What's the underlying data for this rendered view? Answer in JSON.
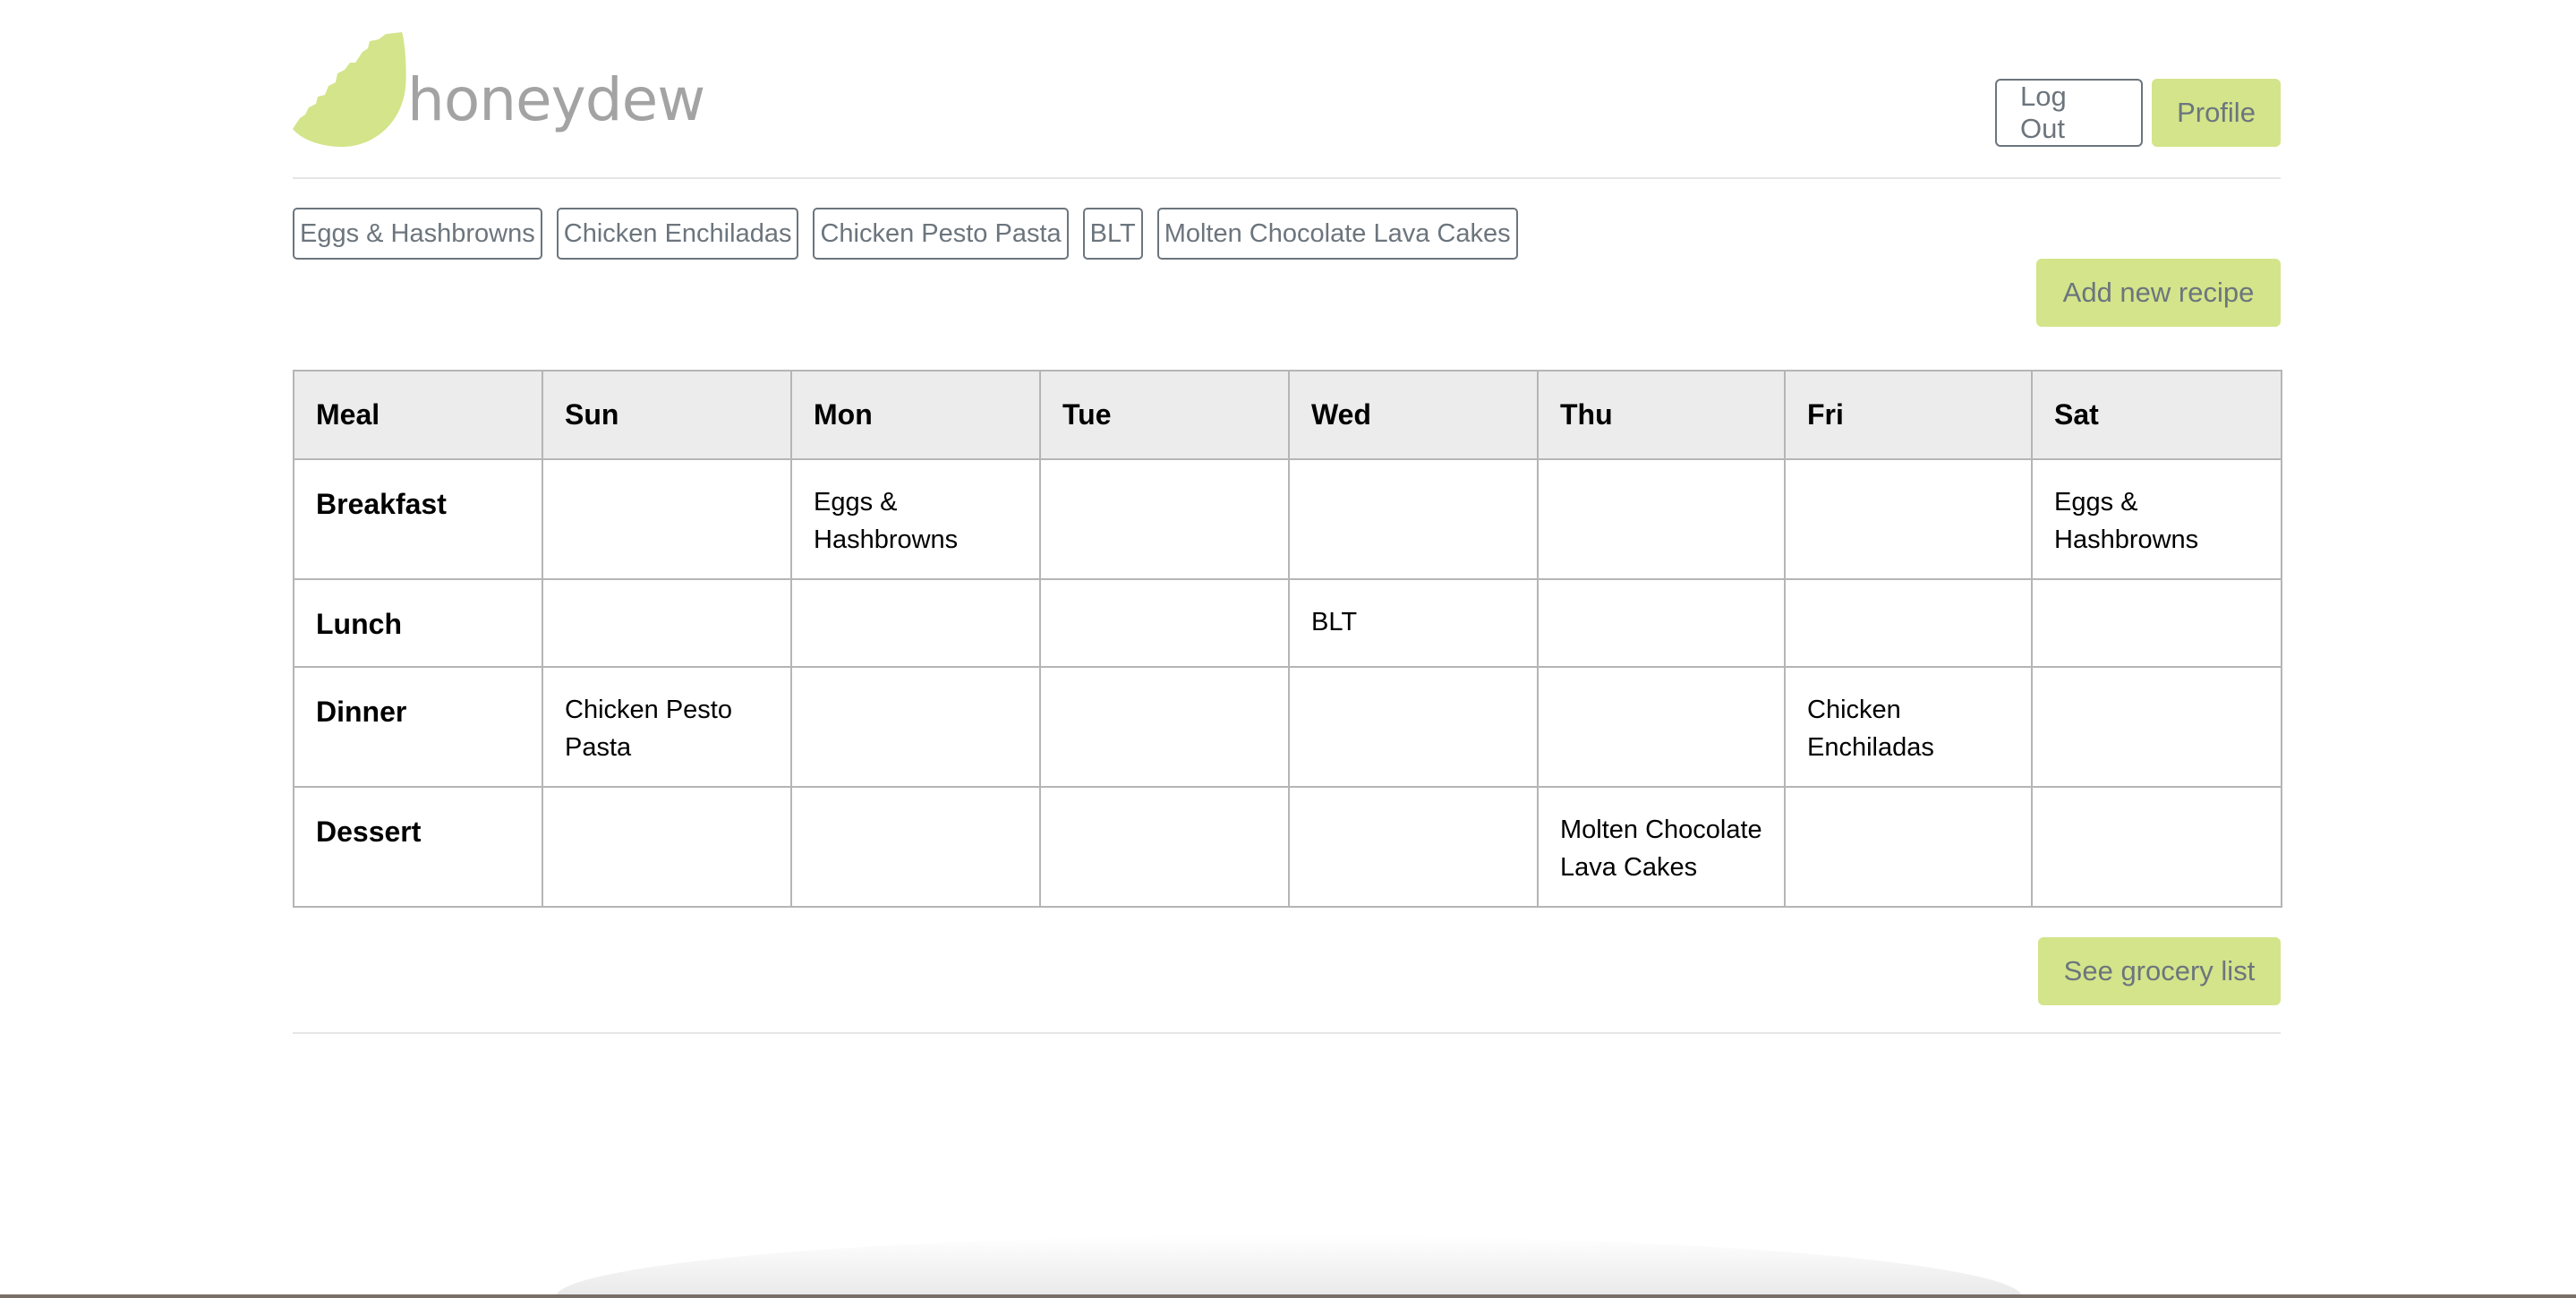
{
  "brand": {
    "name": "honeydew",
    "logo_icon": "honeydew-melon-icon",
    "logo_color": "#d3e48a",
    "text_color": "#a3a3a3"
  },
  "header": {
    "logout_label": "Log Out",
    "profile_label": "Profile"
  },
  "recipes": [
    "Eggs & Hashbrowns",
    "Chicken Enchiladas",
    "Chicken Pesto Pasta",
    "BLT",
    "Molten Chocolate Lava Cakes"
  ],
  "actions": {
    "add_recipe_label": "Add new recipe",
    "grocery_list_label": "See grocery list"
  },
  "planner": {
    "headers": [
      "Meal",
      "Sun",
      "Mon",
      "Tue",
      "Wed",
      "Thu",
      "Fri",
      "Sat"
    ],
    "rows": [
      {
        "meal": "Breakfast",
        "days": [
          "",
          "Eggs & Hashbrowns",
          "",
          "",
          "",
          "",
          "Eggs & Hashbrowns"
        ]
      },
      {
        "meal": "Lunch",
        "days": [
          "",
          "",
          "",
          "BLT",
          "",
          "",
          ""
        ]
      },
      {
        "meal": "Dinner",
        "days": [
          "Chicken Pesto Pasta",
          "",
          "",
          "",
          "",
          "Chicken Enchiladas",
          ""
        ]
      },
      {
        "meal": "Dessert",
        "days": [
          "",
          "",
          "",
          "",
          "Molten Chocolate Lava Cakes",
          "",
          ""
        ]
      }
    ]
  },
  "colors": {
    "accent": "#d3e48a",
    "button_text": "#6c757d",
    "table_header_bg": "#ececec",
    "border": "#b5b5b5"
  }
}
